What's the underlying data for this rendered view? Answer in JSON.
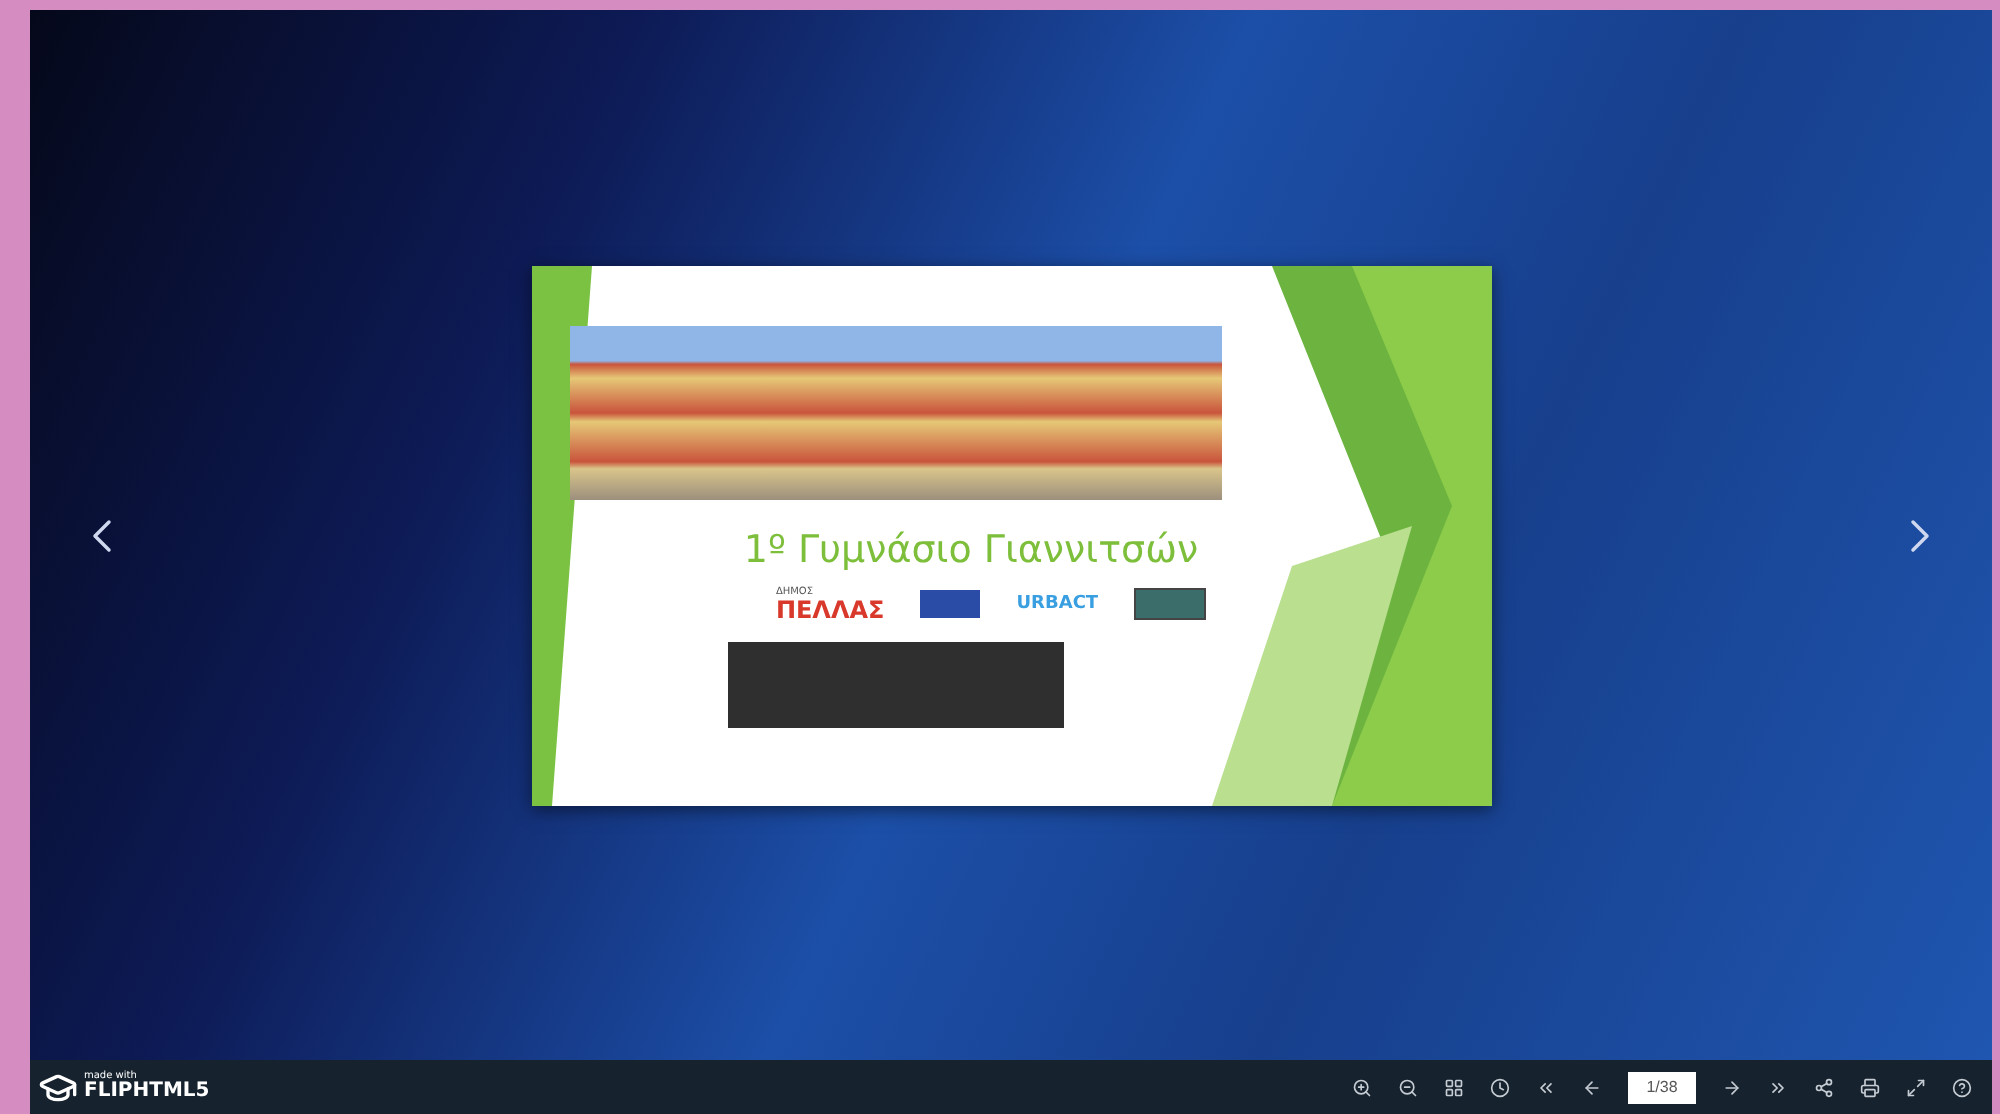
{
  "slide": {
    "title": "1º Γυμνάσιο Γιαννιτσών",
    "logos": [
      {
        "kind": "municipality",
        "small": "ΔΗΜΟΣ",
        "text": "ΠΕΛΛΑΣ"
      },
      {
        "kind": "eu"
      },
      {
        "kind": "urbact",
        "text": "URBACT"
      },
      {
        "kind": "urb"
      }
    ]
  },
  "toolbar": {
    "brand_small": "made with",
    "brand": "FLIPHTML5",
    "page": "1/38"
  }
}
